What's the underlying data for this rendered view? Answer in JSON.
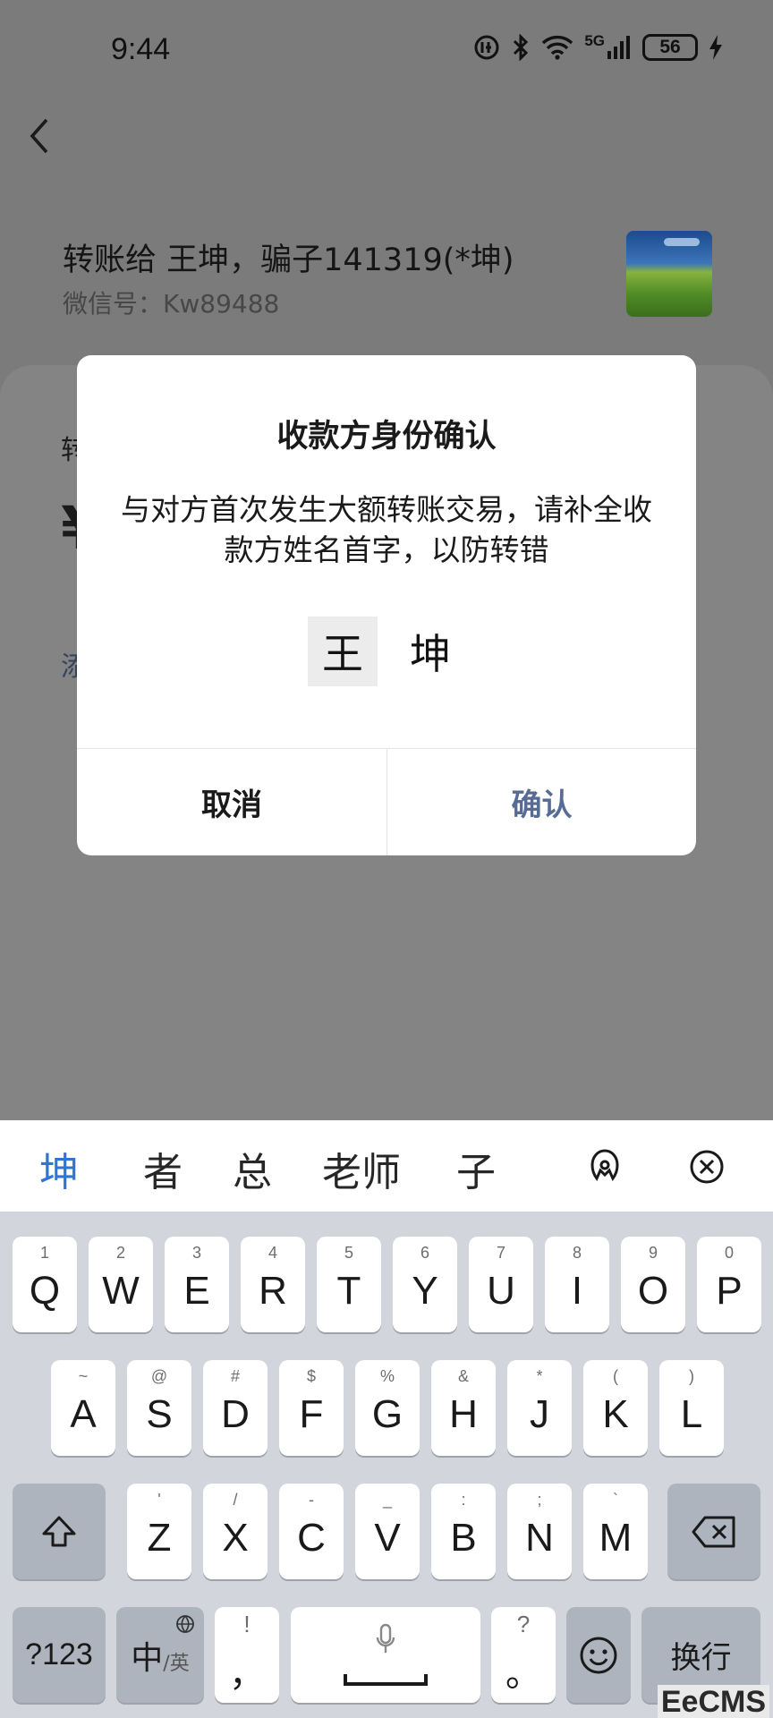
{
  "status_bar": {
    "time": "9:44",
    "network": "5G",
    "battery": "56"
  },
  "payee": {
    "title": "转账给 王坤，骗子141319(*坤)",
    "wechat_id": "微信号：Kw89488"
  },
  "background": {
    "label_fragment": "转",
    "amount_fragment": "¥",
    "link_fragment": "添"
  },
  "dialog": {
    "title": "收款方身份确认",
    "message": "与对方首次发生大额转账交易，请补全收款方姓名首字，以防转错",
    "name_input_value": "王",
    "name_rest": "坤",
    "cancel_label": "取消",
    "confirm_label": "确认",
    "confirm_color": "#576b95"
  },
  "candidates": {
    "items": [
      "坤",
      "者",
      "总",
      "老师",
      "子"
    ],
    "active_color": "#2f75d6"
  },
  "keyboard": {
    "row1": [
      {
        "hint": "1",
        "key": "Q"
      },
      {
        "hint": "2",
        "key": "W"
      },
      {
        "hint": "3",
        "key": "E"
      },
      {
        "hint": "4",
        "key": "R"
      },
      {
        "hint": "5",
        "key": "T"
      },
      {
        "hint": "6",
        "key": "Y"
      },
      {
        "hint": "7",
        "key": "U"
      },
      {
        "hint": "8",
        "key": "I"
      },
      {
        "hint": "9",
        "key": "O"
      },
      {
        "hint": "0",
        "key": "P"
      }
    ],
    "row2": [
      {
        "hint": "~",
        "key": "A"
      },
      {
        "hint": "@",
        "key": "S"
      },
      {
        "hint": "#",
        "key": "D"
      },
      {
        "hint": "$",
        "key": "F"
      },
      {
        "hint": "%",
        "key": "G"
      },
      {
        "hint": "&",
        "key": "H"
      },
      {
        "hint": "*",
        "key": "J"
      },
      {
        "hint": "(",
        "key": "K"
      },
      {
        "hint": ")",
        "key": "L"
      }
    ],
    "row3": [
      {
        "hint": "'",
        "key": "Z"
      },
      {
        "hint": "/",
        "key": "X"
      },
      {
        "hint": "-",
        "key": "C"
      },
      {
        "hint": "_",
        "key": "V"
      },
      {
        "hint": ":",
        "key": "B"
      },
      {
        "hint": ";",
        "key": "N"
      },
      {
        "hint": "`",
        "key": "M"
      }
    ],
    "numbers_label": "?123",
    "lang_main": "中",
    "lang_alt": "/英",
    "comma_hint": "!",
    "comma": "，",
    "period_hint": "?",
    "period": "。",
    "enter_label": "换行"
  },
  "watermark": "EeCMS"
}
